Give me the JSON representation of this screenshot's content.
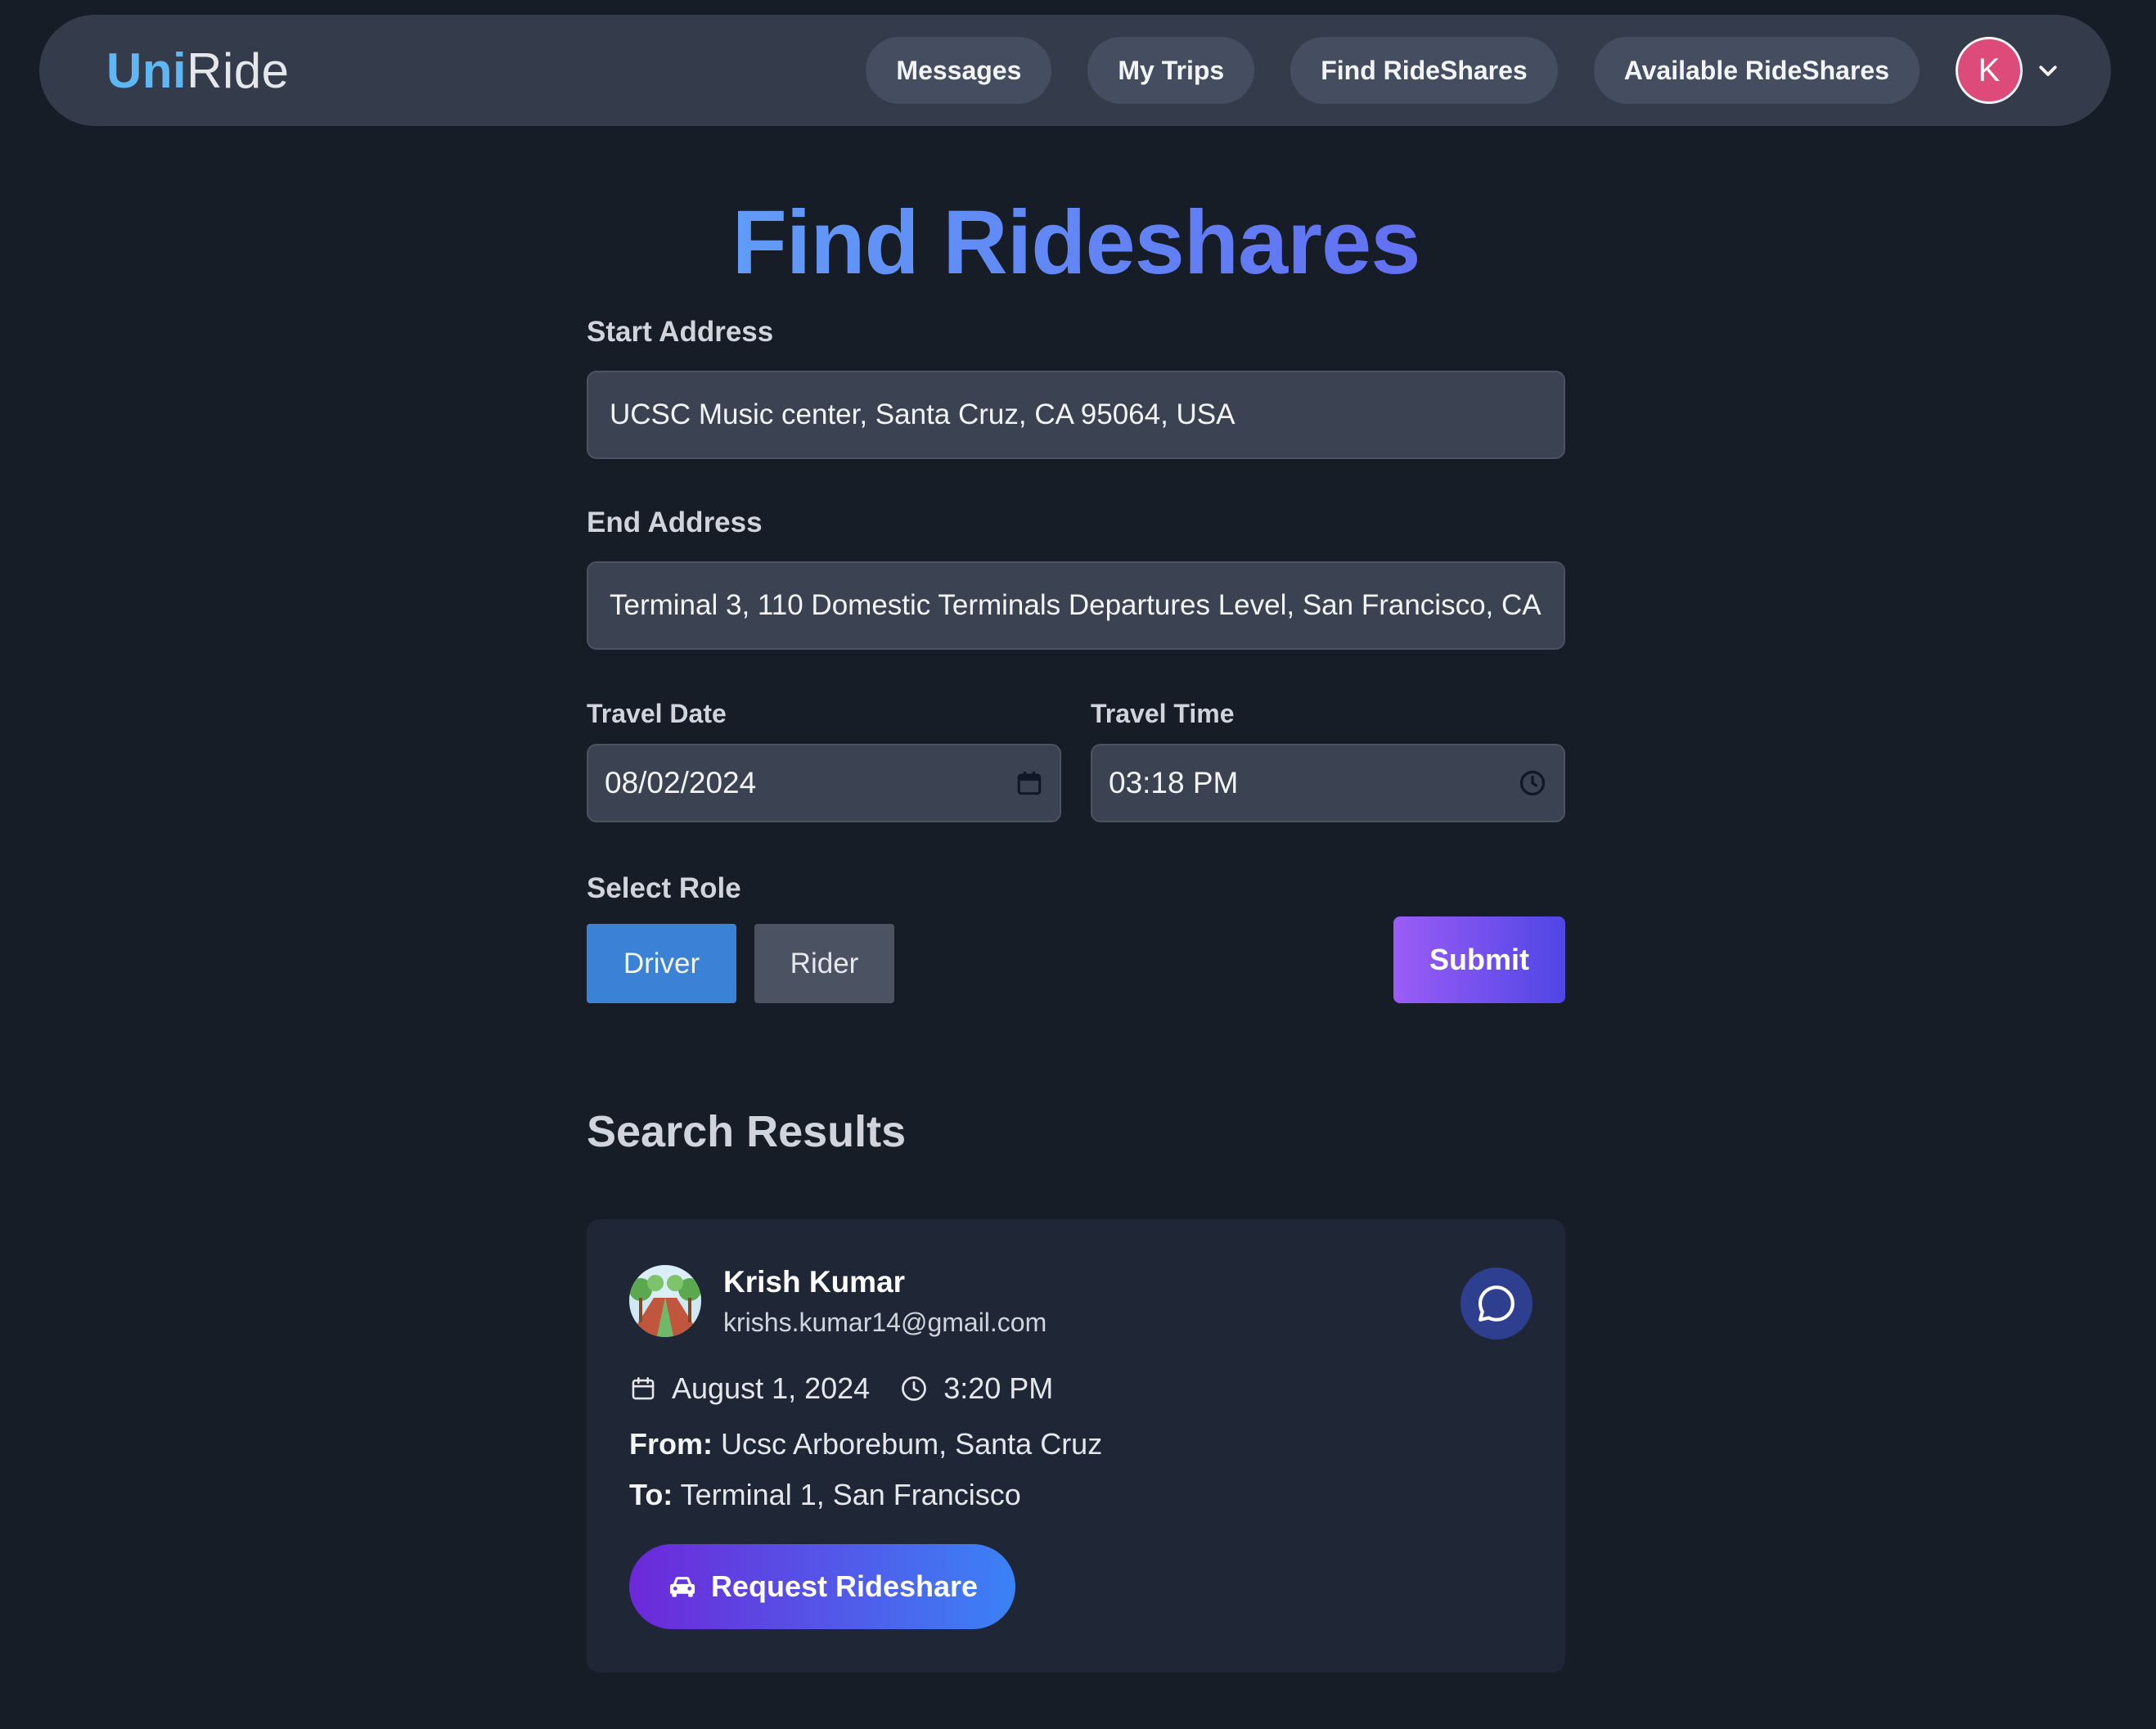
{
  "nav": {
    "brand_part1": "Uni",
    "brand_part2": "Ride",
    "links": [
      "Messages",
      "My Trips",
      "Find RideShares",
      "Available RideShares"
    ],
    "avatar_initial": "K"
  },
  "form": {
    "title": "Find Rideshares",
    "start_label": "Start Address",
    "start_value": "UCSC Music center, Santa Cruz, CA 95064, USA",
    "end_label": "End Address",
    "end_value": "Terminal 3, 110 Domestic Terminals Departures Level, San Francisco, CA",
    "date_label": "Travel Date",
    "date_value": "08/02/2024",
    "time_label": "Travel Time",
    "time_value": "03:18 PM",
    "role_label": "Select Role",
    "roles": [
      "Driver",
      "Rider"
    ],
    "selected_role": "Driver",
    "submit_label": "Submit"
  },
  "results": {
    "title": "Search Results",
    "items": [
      {
        "name": "Krish Kumar",
        "email": "krishs.kumar14@gmail.com",
        "date": "August 1, 2024",
        "time": "3:20 PM",
        "from_label": "From:",
        "from": "Ucsc Arborebum, Santa Cruz",
        "to_label": "To:",
        "to": "Terminal 1, San Francisco",
        "request_label": "Request Rideshare"
      }
    ]
  },
  "colors": {
    "background": "#171d27",
    "navbar": "#343b4b",
    "accent_blue": "#60b6f3",
    "driver_selected": "#3b82d6",
    "submit_gradient": [
      "#9b5cf6",
      "#4f46e5"
    ],
    "request_gradient": [
      "#6d28d9",
      "#3b82f6"
    ],
    "avatar": "#dc4b7a"
  },
  "icons": {
    "avatar_menu": "chevron-down-icon",
    "date": "calendar-icon",
    "time": "clock-icon",
    "chat": "chat-bubble-icon",
    "request": "car-icon"
  }
}
